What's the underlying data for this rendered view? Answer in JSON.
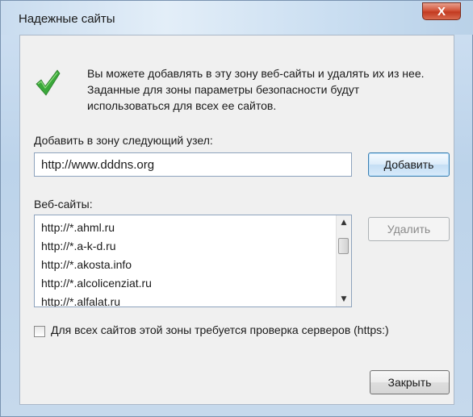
{
  "window": {
    "title": "Надежные сайты",
    "close_glyph": "X"
  },
  "info": {
    "icon": "green-checkmark-icon",
    "text": "Вы можете добавлять в эту зону  веб-сайты и удалять их из нее. Заданные для зоны параметры безопасности будут использоваться для всех ее сайтов."
  },
  "add_zone": {
    "label": "Добавить в зону следующий узел:",
    "input_value": "http://www.dddns.org",
    "add_button": "Добавить"
  },
  "websites": {
    "label": "Веб-сайты:",
    "items": [
      "http://*.ahml.ru",
      "http://*.a-k-d.ru",
      "http://*.akosta.info",
      "http://*.alcolicenziat.ru",
      "http://*.alfalat.ru"
    ],
    "remove_button": "Удалить"
  },
  "https_check": {
    "label": "Для всех сайтов этой зоны требуется проверка серверов (https:)",
    "checked": false
  },
  "footer": {
    "close_button": "Закрыть"
  },
  "colors": {
    "check_green": "#3aa83a",
    "close_red": "#c23a20",
    "focus_border": "#3c7fb1"
  }
}
